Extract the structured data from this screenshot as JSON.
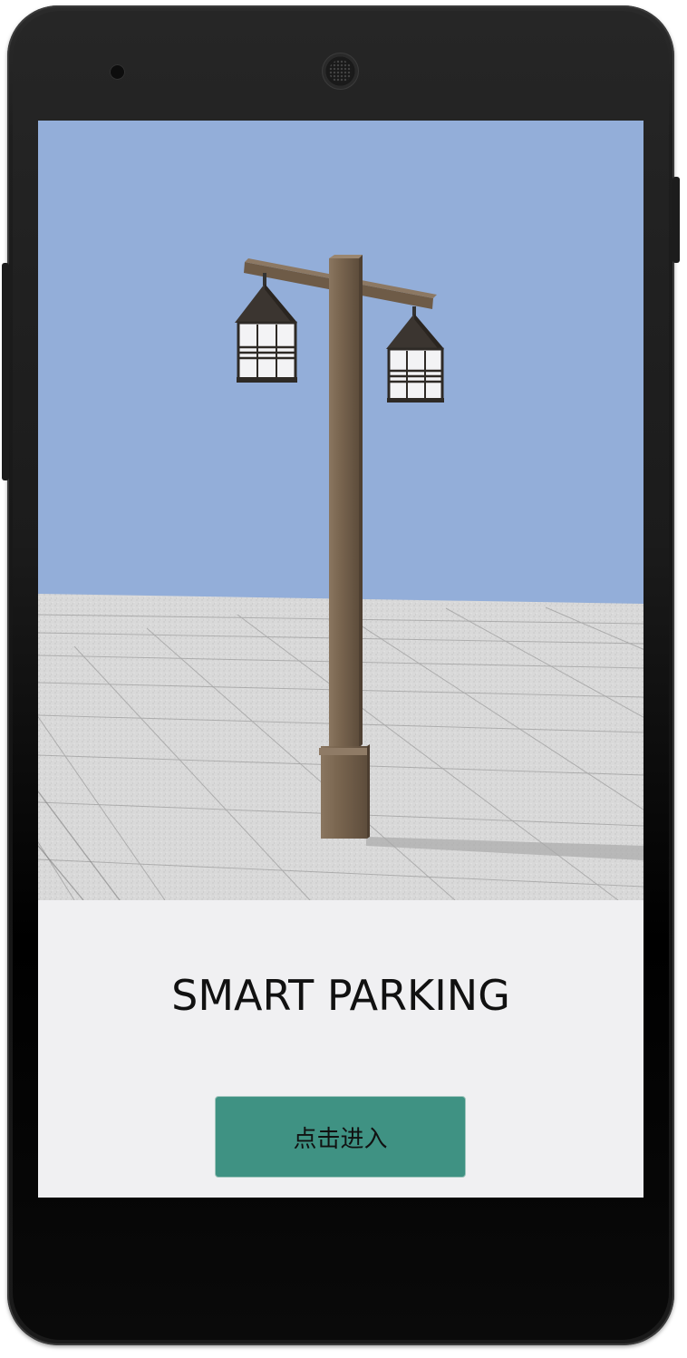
{
  "app": {
    "title": "SMART PARKING",
    "enter_button_label": "点击进入"
  },
  "hero": {
    "image_semantic": "street-lamp-illustration"
  },
  "colors": {
    "sky": "#93aed9",
    "ground": "#d8d8d8",
    "accent": "#3f9283",
    "screen_background": "#f0f0f2",
    "phone_body": "#1a1a1a"
  }
}
